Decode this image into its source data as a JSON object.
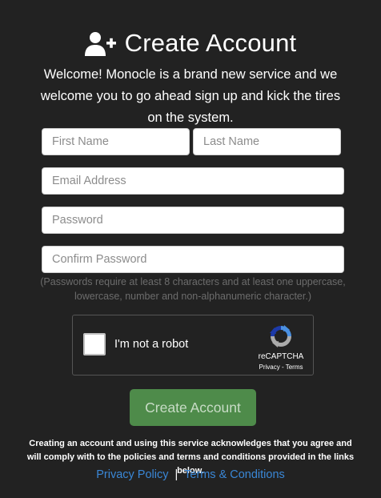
{
  "header": {
    "title": "Create Account",
    "icon": "user-plus-icon"
  },
  "welcome_text": "Welcome! Monocle is a brand new service and we welcome you to go ahead sign up and kick the tires on the system.",
  "form": {
    "first_name_placeholder": "First Name",
    "last_name_placeholder": "Last Name",
    "email_placeholder": "Email Address",
    "password_placeholder": "Password",
    "confirm_password_placeholder": "Confirm Password",
    "password_hint": "(Passwords require at least 8 characters and at least one uppercase, lowercase, number and non-alphanumeric character.)"
  },
  "recaptcha": {
    "label": "I'm not a robot",
    "brand": "reCAPTCHA",
    "privacy": "Privacy",
    "separator": "-",
    "terms": "Terms"
  },
  "submit_label": "Create Account",
  "legal_text": "Creating an account and using this service acknowledges that you agree and will comply with to the policies and terms and conditions provided in the links below.",
  "footer_links": {
    "privacy_policy": "Privacy Policy",
    "separator": "|",
    "terms_conditions": "Terms & Conditions"
  },
  "colors": {
    "background": "#222222",
    "primary_button": "#4e8b4a",
    "link": "#3a87d6"
  }
}
